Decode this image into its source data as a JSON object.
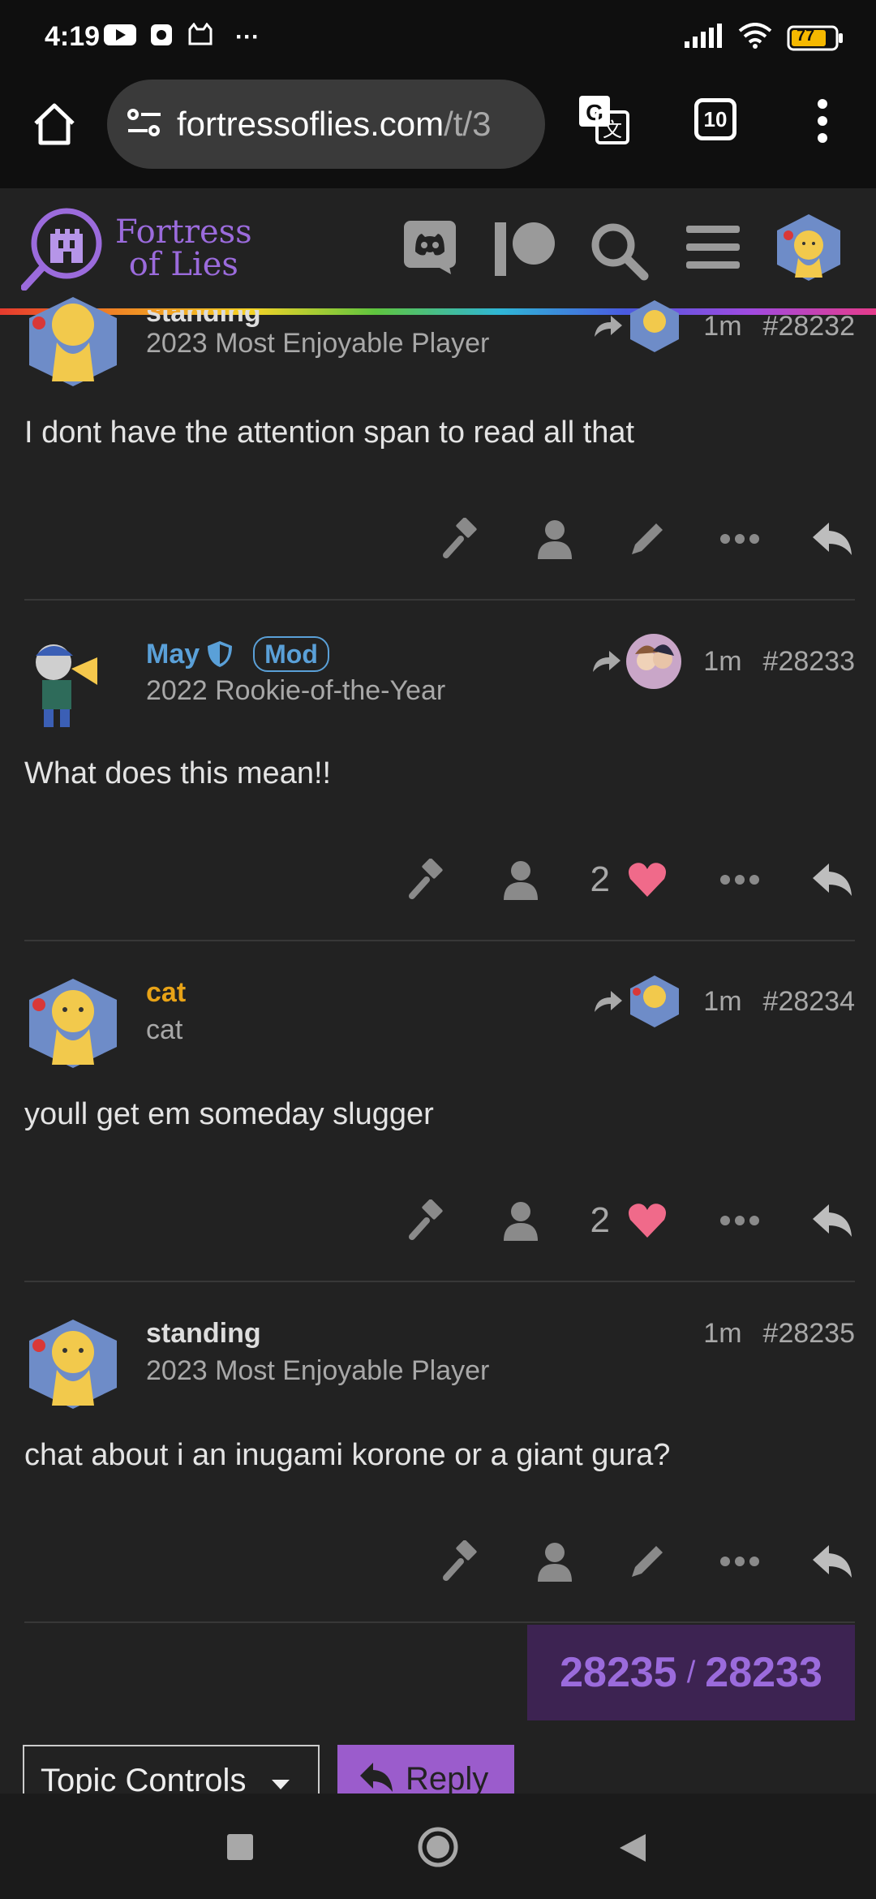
{
  "status_bar": {
    "time": "4:19",
    "more": "···",
    "battery": "77"
  },
  "browser": {
    "url_domain": "fortressoflies.com",
    "url_path": "/t/3",
    "tab_count": "10"
  },
  "site": {
    "logo_line1": "Fortress",
    "logo_line2": "of Lies"
  },
  "posts": [
    {
      "name": "standing",
      "title": "2023 Most Enjoyable Player",
      "time": "1m",
      "number": "#28232",
      "body": "I dont have the attention span to read all that"
    },
    {
      "name": "May",
      "badge": "Mod",
      "title": "2022 Rookie-of-the-Year",
      "time": "1m",
      "number": "#28233",
      "body": "What does this mean!!",
      "likes": "2"
    },
    {
      "name": "cat",
      "title": "cat",
      "time": "1m",
      "number": "#28234",
      "body": "youll get em someday slugger",
      "likes": "2"
    },
    {
      "name": "standing",
      "title": "2023 Most Enjoyable Player",
      "time": "1m",
      "number": "#28235",
      "body": "chat about i an inugami korone or a giant gura?"
    }
  ],
  "progress": {
    "current": "28235",
    "separator": "/",
    "total": "28233"
  },
  "controls": {
    "topic_controls": "Topic Controls",
    "reply": "Reply"
  },
  "colors": {
    "accent": "#9b6bdc",
    "mod_blue": "#5aa0d8",
    "cat_gold": "#e8a317",
    "heart": "#f06a8a"
  }
}
